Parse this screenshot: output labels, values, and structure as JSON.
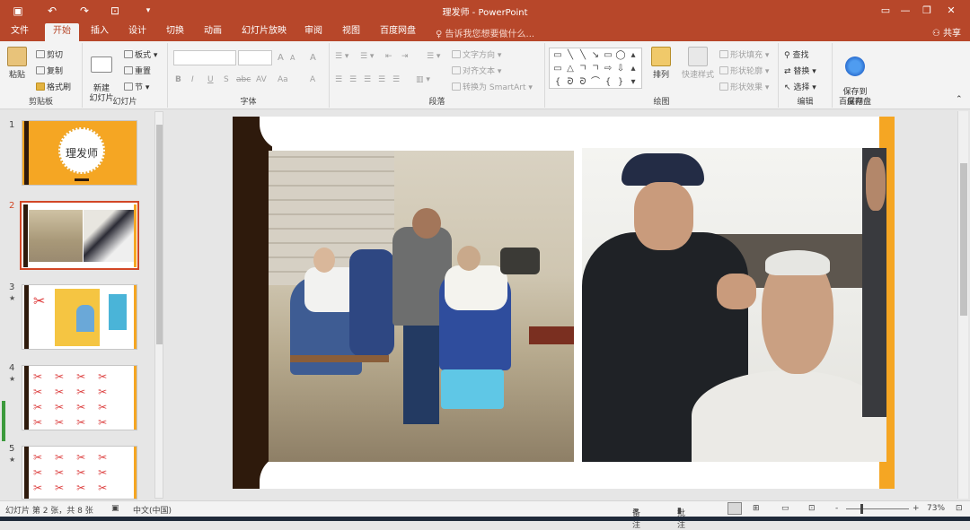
{
  "app": {
    "window_title": "理发师 - PowerPoint",
    "qat": {
      "save_icon": "save-icon",
      "undo_icon": "undo-icon",
      "redo_icon": "redo-icon",
      "present_icon": "start-from-beginning-icon",
      "customize_icon": "customize-qat-icon"
    },
    "window_buttons": {
      "ribbon_display": "ribbon-display-options-icon",
      "minimize": "minimize-icon",
      "restore": "restore-icon",
      "close": "close-icon"
    }
  },
  "tabs": [
    {
      "label": "文件"
    },
    {
      "label": "开始",
      "active": true
    },
    {
      "label": "插入"
    },
    {
      "label": "设计"
    },
    {
      "label": "切换"
    },
    {
      "label": "动画"
    },
    {
      "label": "幻灯片放映"
    },
    {
      "label": "审阅"
    },
    {
      "label": "视图"
    },
    {
      "label": "百度网盘"
    }
  ],
  "tell_me": {
    "placeholder": "告诉我您想要做什么..."
  },
  "share": {
    "label": "共享"
  },
  "ribbon": {
    "clipboard": {
      "label": "剪贴板",
      "paste": "粘贴",
      "cut": "剪切",
      "copy": "复制",
      "format_painter": "格式刷"
    },
    "slides": {
      "label": "幻灯片",
      "new_slide": "新建\n幻灯片",
      "layout": "板式",
      "reset": "重置",
      "section": "节"
    },
    "font": {
      "label": "字体",
      "font_name": "",
      "font_size": "",
      "bold": "B",
      "italic": "I",
      "underline": "U",
      "shadow": "S",
      "strike": "abc",
      "spacing": "AV",
      "case": "Aa",
      "grow": "A",
      "shrink": "A",
      "clear": "A",
      "color": "A"
    },
    "paragraph": {
      "label": "段落",
      "text_direction": "文字方向",
      "align_text": "对齐文本",
      "convert_smartart": "转换为 SmartArt"
    },
    "drawing": {
      "label": "绘图",
      "arrange": "排列",
      "quick_styles": "快速样式",
      "shape_fill": "形状填充",
      "shape_outline": "形状轮廓",
      "shape_effects": "形状效果",
      "shapes": [
        "▭",
        "╲",
        "╲",
        "↘",
        "▭",
        "◯",
        "▴",
        "▭",
        "△",
        "ㄱ",
        "ㄱ",
        "⇨",
        "⇩",
        "▴",
        "{",
        "ᘐ",
        "ᘐ",
        "⌒",
        "{",
        "}",
        "▾"
      ]
    },
    "editing": {
      "label": "编辑",
      "find": "查找",
      "replace": "替换",
      "select": "选择"
    },
    "save": {
      "label": "保存",
      "save_to_baidu": "保存到\n百度网盘"
    }
  },
  "thumbnails": [
    {
      "number": "1",
      "title": "理发师",
      "has_transition": false
    },
    {
      "number": "2",
      "has_transition": false,
      "selected": true
    },
    {
      "number": "3",
      "has_transition": true
    },
    {
      "number": "4",
      "has_transition": true
    },
    {
      "number": "5",
      "has_transition": true
    }
  ],
  "status": {
    "slide_info": "幻灯片 第 2 张，共 8 张",
    "language": "中文(中国)",
    "notes": "备注",
    "comments": "批注",
    "zoom": "73%",
    "zoom_minus": "-",
    "zoom_plus": "+"
  },
  "colors": {
    "accent": "#b7472a",
    "slide_orange": "#f5a623",
    "slide_dark": "#2e1a0c"
  }
}
